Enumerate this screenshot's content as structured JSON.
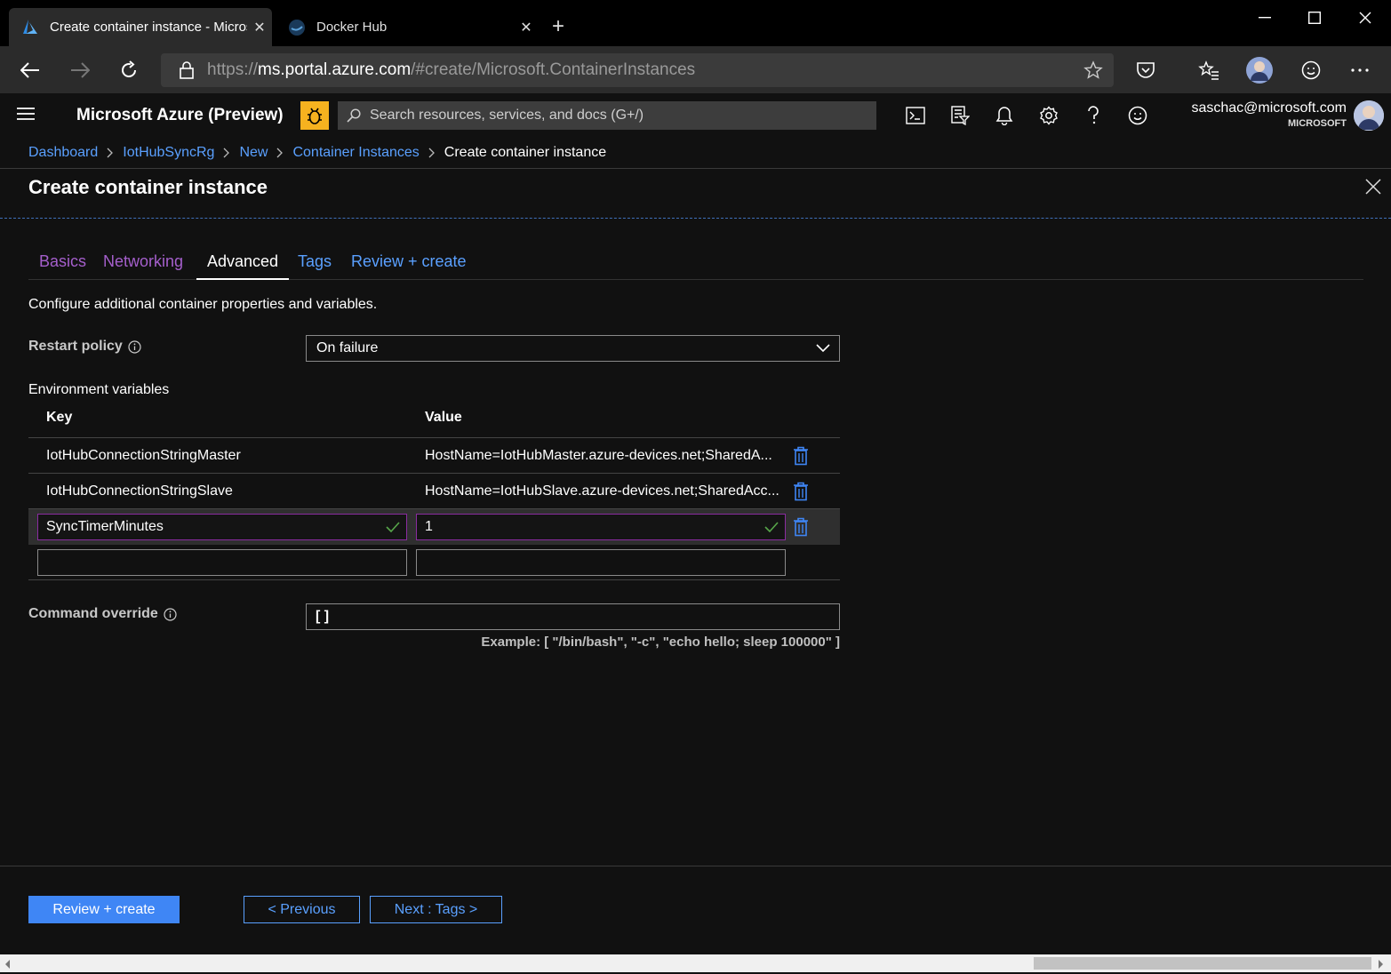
{
  "browser": {
    "tabs": [
      {
        "title": "Create container instance - Microsoft Azure"
      },
      {
        "title": "Docker Hub"
      }
    ],
    "url": {
      "scheme": "https://",
      "host": "ms.portal.azure.com",
      "path": "/#create/Microsoft.ContainerInstances"
    }
  },
  "portal": {
    "brand": "Microsoft Azure (Preview)",
    "search_placeholder": "Search resources, services, and docs (G+/)",
    "account": {
      "email": "saschac@microsoft.com",
      "org": "MICROSOFT"
    }
  },
  "breadcrumb": [
    "Dashboard",
    "IotHubSyncRg",
    "New",
    "Container Instances"
  ],
  "breadcrumb_current": "Create container instance",
  "blade": {
    "title": "Create container instance",
    "tabs": [
      {
        "label": "Basics"
      },
      {
        "label": "Networking"
      },
      {
        "label": "Advanced"
      },
      {
        "label": "Tags"
      },
      {
        "label": "Review + create"
      }
    ],
    "intro": "Configure additional container properties and variables.",
    "restart_policy": {
      "label": "Restart policy",
      "value": "On failure"
    },
    "env": {
      "label": "Environment variables",
      "key_header": "Key",
      "value_header": "Value",
      "rows": [
        {
          "key": "IotHubConnectionStringMaster",
          "value": "HostName=IotHubMaster.azure-devices.net;SharedA..."
        },
        {
          "key": "IotHubConnectionStringSlave",
          "value": "HostName=IotHubSlave.azure-devices.net;SharedAcc..."
        }
      ],
      "editing": {
        "key": "SyncTimerMinutes",
        "value": "1"
      }
    },
    "command_override": {
      "label": "Command override",
      "value": "[ ]",
      "example": "Example: [ \"/bin/bash\", \"-c\", \"echo hello; sleep 100000\" ]"
    },
    "buttons": {
      "review": "Review + create",
      "previous": "< Previous",
      "next": "Next : Tags >"
    }
  },
  "colors": {
    "accent": "#3f86f5",
    "link": "#5aa0ff",
    "visited": "#a55fcc",
    "valid": "#57a64a",
    "feedback_bug": "#f6b21f"
  }
}
